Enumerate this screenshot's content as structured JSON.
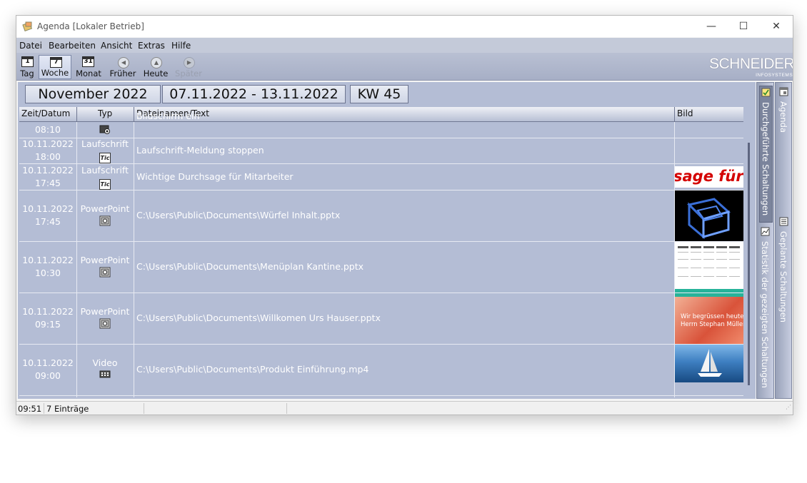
{
  "window": {
    "title": "Agenda [Lokaler Betrieb]"
  },
  "menu": [
    "Datei",
    "Bearbeiten",
    "Ansicht",
    "Extras",
    "Hilfe"
  ],
  "toolbar": {
    "tag": {
      "label": "Tag",
      "icon_text": "1"
    },
    "woche": {
      "label": "Woche",
      "icon_text": "7"
    },
    "monat": {
      "label": "Monat",
      "icon_text": "31"
    },
    "frueher": "Früher",
    "heute": "Heute",
    "spaeter": "Später"
  },
  "logo": {
    "main": "SCHNEIDER",
    "sub": "INFOSYSTEMS"
  },
  "datebar": {
    "month": "November 2022",
    "range": "07.11.2022 - 13.11.2022",
    "week": "KW 45"
  },
  "columns": {
    "date": "Zeit/Datum",
    "type": "Typ",
    "text": "Dateinamen/Text",
    "image": "Bild"
  },
  "rows": [
    {
      "date": "",
      "time": "08:10",
      "type": "",
      "icon": "screen-icon",
      "text": "Bildschirm ein"
    },
    {
      "date": "10.11.2022",
      "time": "18:00",
      "type": "Laufschrift",
      "icon": "ticker-icon",
      "text": "Laufschrift-Meldung stoppen"
    },
    {
      "date": "10.11.2022",
      "time": "17:45",
      "type": "Laufschrift",
      "icon": "ticker-icon",
      "text": "Wichtige Durchsage für Mitarbeiter",
      "thumb_text": "sage für"
    },
    {
      "date": "10.11.2022",
      "time": "17:45",
      "type": "PowerPoint",
      "icon": "powerpoint-icon",
      "text": "C:\\Users\\Public\\Documents\\Würfel Inhalt.pptx"
    },
    {
      "date": "10.11.2022",
      "time": "10:30",
      "type": "PowerPoint",
      "icon": "powerpoint-icon",
      "text": "C:\\Users\\Public\\Documents\\Menüplan Kantine.pptx"
    },
    {
      "date": "10.11.2022",
      "time": "09:15",
      "type": "PowerPoint",
      "icon": "powerpoint-icon",
      "text": "C:\\Users\\Public\\Documents\\Willkomen Urs Hauser.pptx",
      "thumb_text_1": "Wir begrüssen heute",
      "thumb_text_2": "Herrn Stephan Müller"
    },
    {
      "date": "10.11.2022",
      "time": "09:00",
      "type": "Video",
      "icon": "video-icon",
      "text": "C:\\Users\\Public\\Documents\\Produkt Einführung.mp4"
    }
  ],
  "side_tabs": {
    "durchgefuehrt": "Durchgeführte Schaltungen",
    "statistik": "Statistik der gezeigten Schaltungen",
    "agenda": "Agenda",
    "geplant": "Geplante Schaltungen"
  },
  "status": {
    "time": "09:51",
    "entries": "7 Einträge"
  },
  "colors": {
    "grid_bg": "#b4bdd5",
    "accent": "#d40000"
  }
}
